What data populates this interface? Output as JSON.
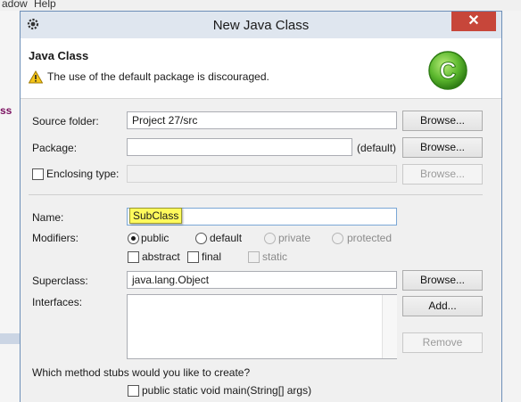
{
  "ide": {
    "menu_left": "adow",
    "menu_help": "Help",
    "side_text": "ss"
  },
  "window": {
    "title": "New Java Class",
    "close_symbol": "✕"
  },
  "header": {
    "title": "Java Class",
    "message": "The use of the default package is discouraged.",
    "logo_letter": "C",
    "warning_icon": "warning-triangle"
  },
  "form": {
    "source_folder": {
      "label": "Source folder:",
      "value": "Project 27/src",
      "button": "Browse..."
    },
    "package": {
      "label": "Package:",
      "value": "",
      "suffix": "(default)",
      "button": "Browse..."
    },
    "enclosing": {
      "label": "Enclosing type:",
      "checked": false,
      "value": "",
      "button": "Browse..."
    },
    "name": {
      "label": "Name:",
      "value": "SubClass"
    },
    "modifiers": {
      "label": "Modifiers:",
      "access": [
        {
          "label": "public",
          "selected": true,
          "enabled": true
        },
        {
          "label": "default",
          "selected": false,
          "enabled": true
        },
        {
          "label": "private",
          "selected": false,
          "enabled": false
        },
        {
          "label": "protected",
          "selected": false,
          "enabled": false
        }
      ],
      "flags": [
        {
          "label": "abstract",
          "checked": false,
          "enabled": true
        },
        {
          "label": "final",
          "checked": false,
          "enabled": true
        },
        {
          "label": "static",
          "checked": false,
          "enabled": false
        }
      ]
    },
    "superclass": {
      "label": "Superclass:",
      "value": "java.lang.Object",
      "button": "Browse..."
    },
    "interfaces": {
      "label": "Interfaces:",
      "add_button": "Add...",
      "remove_button": "Remove"
    },
    "stubs": {
      "question": "Which method stubs would you like to create?",
      "main_label": "public static void main(String[] args)",
      "main_checked": false
    }
  },
  "colors": {
    "accent_green": "#5cb82e",
    "highlight": "#fffa5c",
    "close_red": "#c7463a"
  }
}
